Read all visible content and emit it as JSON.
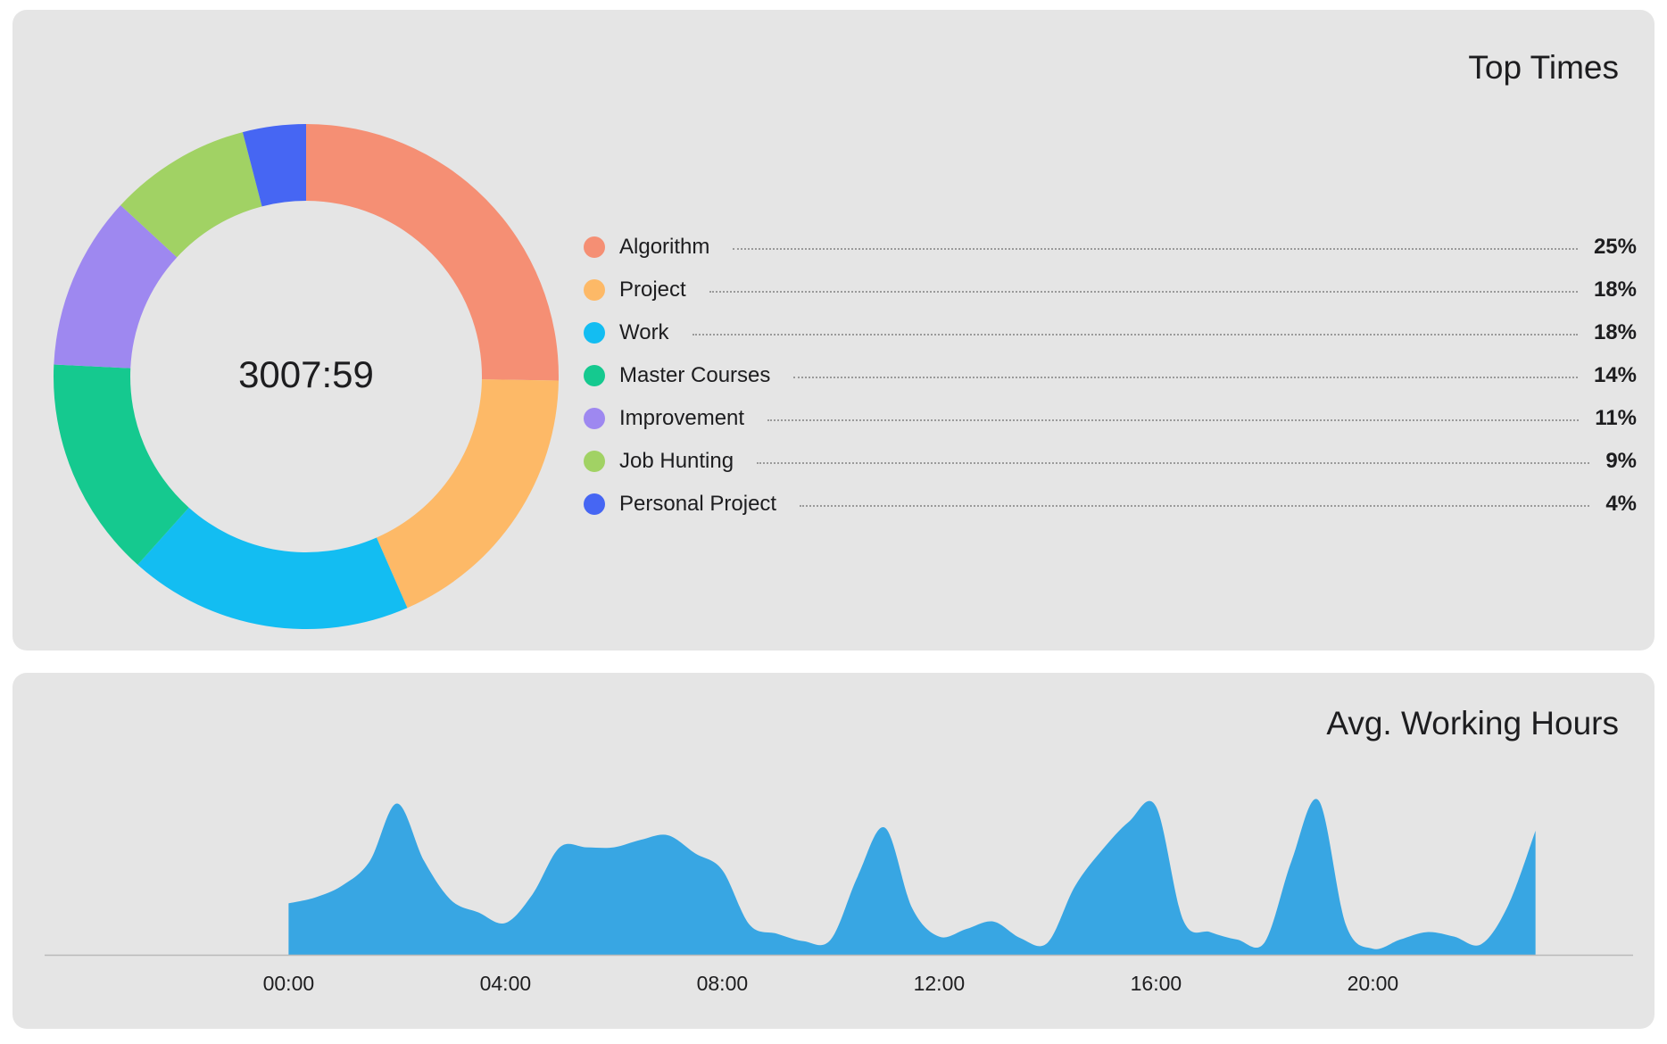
{
  "top_times": {
    "title": "Top Times",
    "total": "3007:59"
  },
  "avg_hours": {
    "title": "Avg. Working Hours"
  },
  "chart_data": [
    {
      "type": "pie",
      "variant": "donut",
      "title": "Top Times",
      "center_label": "3007:59",
      "legend_position": "right",
      "slices": [
        {
          "label": "Algorithm",
          "value": 25,
          "display": "25%",
          "color": "#f58f74"
        },
        {
          "label": "Project",
          "value": 18,
          "display": "18%",
          "color": "#fdb967"
        },
        {
          "label": "Work",
          "value": 18,
          "display": "18%",
          "color": "#13bdf2"
        },
        {
          "label": "Master Courses",
          "value": 14,
          "display": "14%",
          "color": "#15c98f"
        },
        {
          "label": "Improvement",
          "value": 11,
          "display": "11%",
          "color": "#9e88f0"
        },
        {
          "label": "Job Hunting",
          "value": 9,
          "display": "9%",
          "color": "#a1d264"
        },
        {
          "label": "Personal Project",
          "value": 4,
          "display": "4%",
          "color": "#4666f3"
        }
      ]
    },
    {
      "type": "area",
      "title": "Avg. Working Hours",
      "color": "#38a6e3",
      "grid": false,
      "xlabel": "",
      "ylabel": "",
      "xlim": [
        -4.5,
        24.8
      ],
      "ylim": [
        0,
        1.05
      ],
      "x_ticks": [
        0,
        4,
        8,
        12,
        16,
        20
      ],
      "x_tick_labels": [
        "00:00",
        "04:00",
        "08:00",
        "12:00",
        "16:00",
        "20:00"
      ],
      "x": [
        0,
        0.5,
        1,
        1.5,
        2,
        2.5,
        3,
        3.5,
        4,
        4.5,
        5,
        5.5,
        6,
        6.5,
        7,
        7.5,
        8,
        8.5,
        9,
        9.5,
        10,
        10.5,
        11,
        11.5,
        12,
        12.5,
        13,
        13.5,
        14,
        14.5,
        15,
        15.5,
        16,
        16.5,
        17,
        17.5,
        18,
        18.5,
        19,
        19.5,
        20,
        20.5,
        21,
        21.5,
        22,
        22.5,
        23
      ],
      "y": [
        0.34,
        0.38,
        0.46,
        0.62,
        1.0,
        0.62,
        0.36,
        0.28,
        0.21,
        0.4,
        0.71,
        0.71,
        0.71,
        0.76,
        0.79,
        0.67,
        0.56,
        0.2,
        0.14,
        0.09,
        0.1,
        0.52,
        0.84,
        0.31,
        0.12,
        0.17,
        0.22,
        0.11,
        0.08,
        0.45,
        0.69,
        0.88,
        0.98,
        0.23,
        0.15,
        0.1,
        0.08,
        0.62,
        1.02,
        0.2,
        0.04,
        0.1,
        0.15,
        0.12,
        0.07,
        0.33,
        0.82
      ]
    }
  ]
}
